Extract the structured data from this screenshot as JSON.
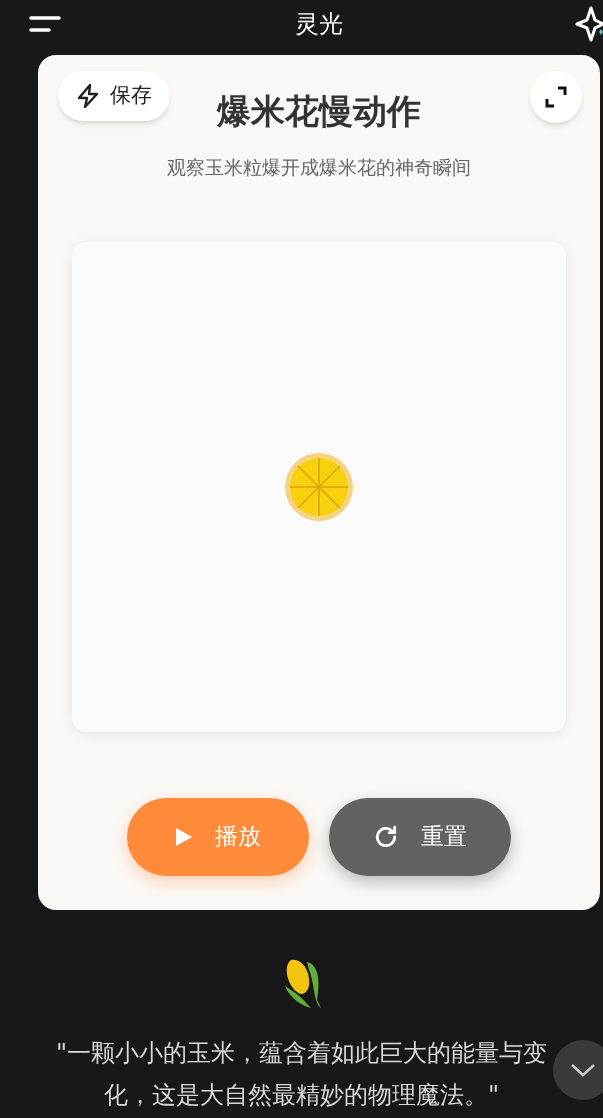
{
  "app_bar": {
    "title": "灵光"
  },
  "card": {
    "save_button": "保存",
    "title": "爆米花慢动作",
    "subtitle": "观察玉米粒爆开成爆米花的神奇瞬间",
    "buttons": [
      {
        "label": "播放",
        "kind": "play"
      },
      {
        "label": "重置",
        "kind": "reset"
      }
    ]
  },
  "quote": "\"一颗小小的玉米，蕴含着如此巨大的能量与变化，这是大自然最精妙的物理魔法。\""
}
